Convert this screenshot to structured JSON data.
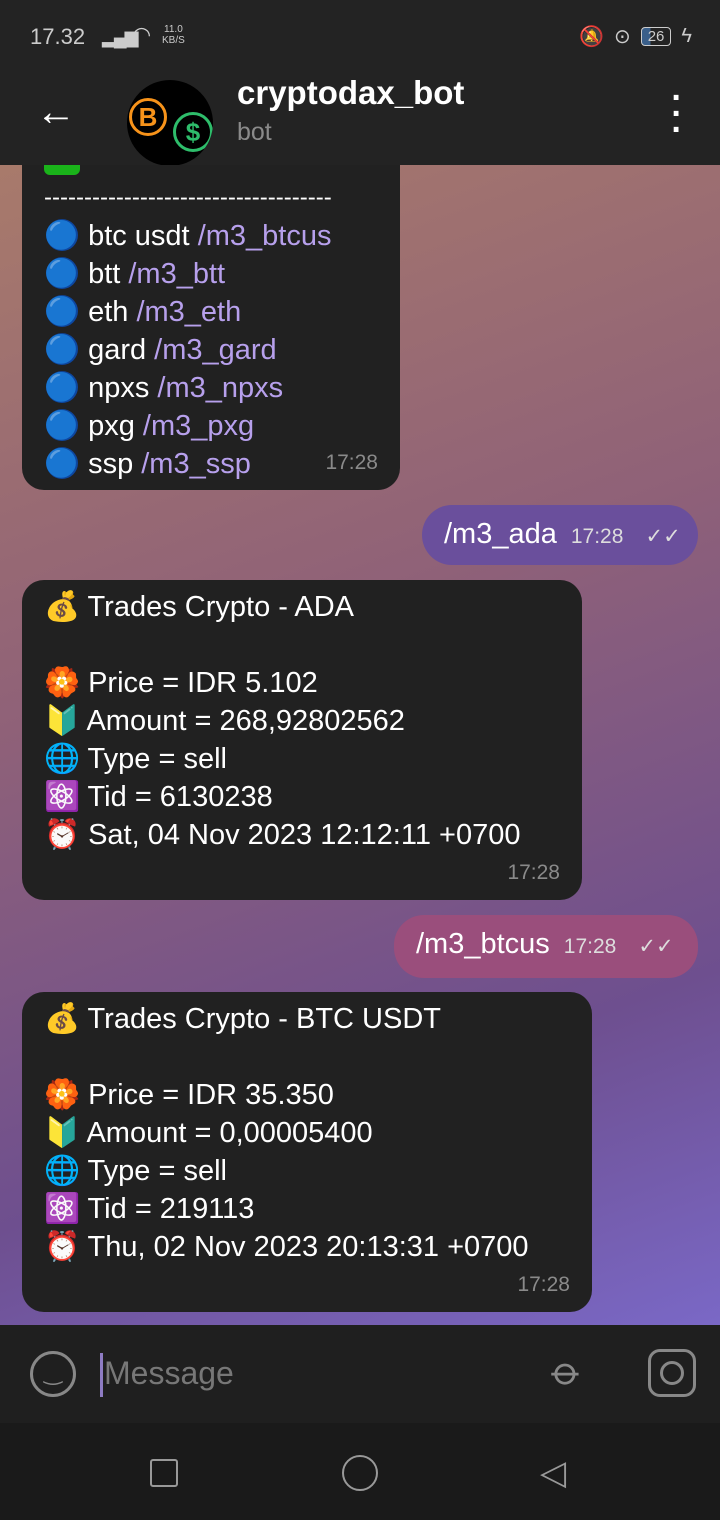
{
  "status_bar": {
    "time": "17.32",
    "net_speed": "11.0",
    "net_unit": "KB/S",
    "battery": "26"
  },
  "header": {
    "title": "cryptodax_bot",
    "subtitle": "bot"
  },
  "messages": [
    {
      "type": "in",
      "separator": "------------------------------------",
      "lines": [
        {
          "emoji": "🔵",
          "text": "btc usdt ",
          "link": "/m3_btcus"
        },
        {
          "emoji": "🔵",
          "text": "btt ",
          "link": "/m3_btt"
        },
        {
          "emoji": "🔵",
          "text": "eth ",
          "link": "/m3_eth"
        },
        {
          "emoji": "🔵",
          "text": "gard ",
          "link": "/m3_gard"
        },
        {
          "emoji": "🔵",
          "text": "npxs ",
          "link": "/m3_npxs"
        },
        {
          "emoji": "🔵",
          "text": "pxg ",
          "link": "/m3_pxg"
        },
        {
          "emoji": "🔵",
          "text": "ssp ",
          "link": "/m3_ssp"
        }
      ],
      "time": "17:28"
    },
    {
      "type": "out",
      "text": "/m3_ada",
      "time": "17:28",
      "status": "read"
    },
    {
      "type": "in",
      "title": "Trades Crypto - ADA",
      "lines": [
        {
          "emoji": "🏵️",
          "text": "Price = IDR 5.102"
        },
        {
          "emoji": "🔰",
          "text": "Amount = 268,92802562"
        },
        {
          "emoji": "🌐",
          "text": "Type = sell"
        },
        {
          "emoji": "⚛️",
          "text": "Tid = 6130238"
        },
        {
          "emoji": "⏰",
          "text": "Sat, 04 Nov 2023 12:12:11 +0700"
        }
      ],
      "time": "17:28"
    },
    {
      "type": "out",
      "text": "/m3_btcus",
      "time": "17:28",
      "status": "read"
    },
    {
      "type": "in",
      "title": "Trades Crypto - BTC USDT",
      "lines": [
        {
          "emoji": "🏵️",
          "text": "Price = IDR 35.350"
        },
        {
          "emoji": "🔰",
          "text": "Amount = 0,00005400"
        },
        {
          "emoji": "🌐",
          "text": "Type = sell"
        },
        {
          "emoji": "⚛️",
          "text": "Tid = 219113"
        },
        {
          "emoji": "⏰",
          "text": "Thu, 02 Nov 2023 20:13:31 +0700"
        }
      ],
      "time": "17:28"
    }
  ],
  "input": {
    "placeholder": "Message"
  },
  "title_emoji": "💰",
  "check": "✓✓"
}
